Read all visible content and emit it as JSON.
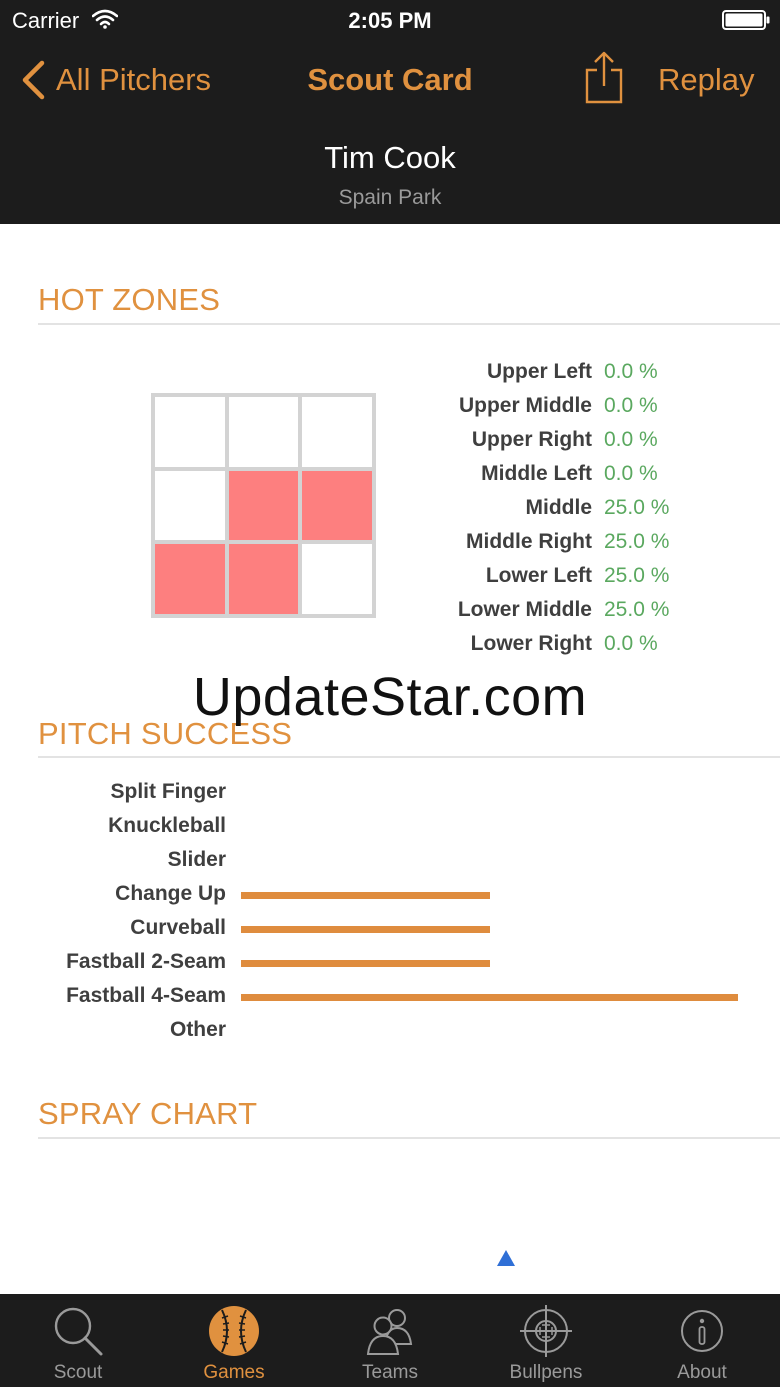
{
  "status_bar": {
    "carrier": "Carrier",
    "time": "2:05 PM"
  },
  "nav": {
    "back_label": "All Pitchers",
    "title": "Scout Card",
    "replay_label": "Replay"
  },
  "pitcher": {
    "name": "Tim Cook",
    "team": "Spain Park"
  },
  "colors": {
    "accent": "#e0913f",
    "hot_zone": "#fd7f7f",
    "percent_green": "#5aa85f",
    "bar": "#df8c3e",
    "dark_bg": "#1c1c1c",
    "marker": "#2f6fd6"
  },
  "hot_zones": {
    "title": "HOT ZONES",
    "grid": [
      [
        false,
        false,
        false
      ],
      [
        false,
        true,
        true
      ],
      [
        true,
        true,
        false
      ]
    ],
    "rows": [
      {
        "label": "Upper Left",
        "value": "0.0 %"
      },
      {
        "label": "Upper Middle",
        "value": "0.0 %"
      },
      {
        "label": "Upper Right",
        "value": "0.0 %"
      },
      {
        "label": "Middle Left",
        "value": "0.0 %"
      },
      {
        "label": "Middle",
        "value": "25.0 %"
      },
      {
        "label": "Middle Right",
        "value": "25.0 %"
      },
      {
        "label": "Lower Left",
        "value": "25.0 %"
      },
      {
        "label": "Lower Middle",
        "value": "25.0 %"
      },
      {
        "label": "Lower Right",
        "value": "0.0 %"
      }
    ]
  },
  "pitch_success": {
    "title": "PITCH SUCCESS",
    "pitches": [
      {
        "label": "Split Finger",
        "value": 0
      },
      {
        "label": "Knuckleball",
        "value": 0
      },
      {
        "label": "Slider",
        "value": 0
      },
      {
        "label": "Change Up",
        "value": 0.5
      },
      {
        "label": "Curveball",
        "value": 0.5
      },
      {
        "label": "Fastball 2-Seam",
        "value": 0.5
      },
      {
        "label": "Fastball 4-Seam",
        "value": 1
      },
      {
        "label": "Other",
        "value": 0
      }
    ]
  },
  "spray_chart": {
    "title": "SPRAY CHART"
  },
  "watermark": "UpdateStar.com",
  "tabs": [
    {
      "label": "Scout",
      "icon": "search-icon",
      "active": false
    },
    {
      "label": "Games",
      "icon": "baseball-icon",
      "active": true
    },
    {
      "label": "Teams",
      "icon": "people-icon",
      "active": false
    },
    {
      "label": "Bullpens",
      "icon": "crosshair-icon",
      "active": false
    },
    {
      "label": "About",
      "icon": "info-icon",
      "active": false
    }
  ]
}
